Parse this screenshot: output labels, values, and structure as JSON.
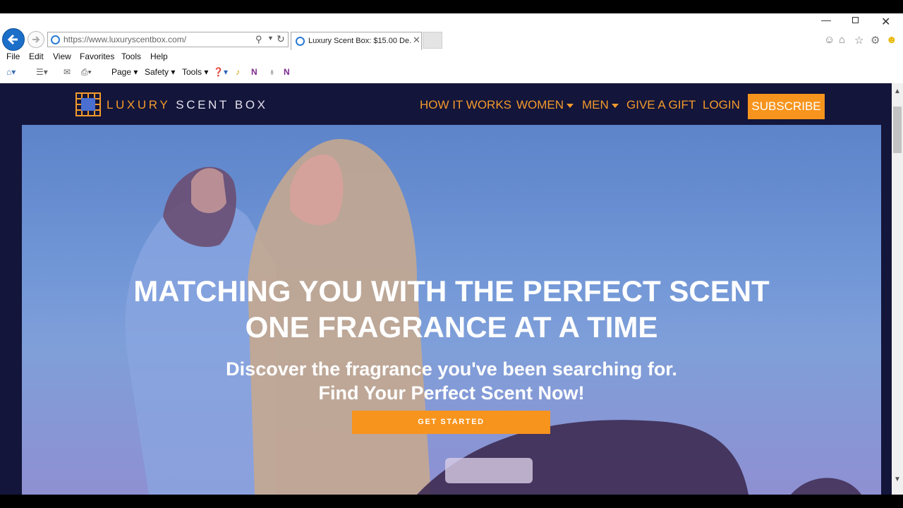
{
  "browser": {
    "address": "https://www.luxuryscentbox.com/",
    "tab_title": "Luxury Scent Box: $15.00 De...",
    "menu": [
      "File",
      "Edit",
      "View",
      "Favorites",
      "Tools",
      "Help"
    ],
    "commands": {
      "page": "Page ▾",
      "safety": "Safety ▾",
      "tools": "Tools ▾"
    }
  },
  "site": {
    "brand_part1": "LUXURY",
    "brand_part2": "SCENT BOX",
    "nav": {
      "how_it_works": "HOW IT WORKS",
      "women": "WOMEN",
      "men": "MEN",
      "give_gift": "GIVE A GIFT",
      "login": "LOGIN",
      "subscribe": "SUBSCRIBE"
    },
    "hero": {
      "title_line1": "MATCHING YOU WITH THE PERFECT SCENT",
      "title_line2": "ONE FRAGRANCE AT A TIME",
      "sub_line1": "Discover the fragrance you've been searching for.",
      "sub_line2": "Find Your Perfect Scent Now!",
      "cta": "GET STARTED"
    }
  },
  "colors": {
    "accent": "#f7941d",
    "nav_bg": "#13153a",
    "browser_blue": "#1c6fc9"
  }
}
